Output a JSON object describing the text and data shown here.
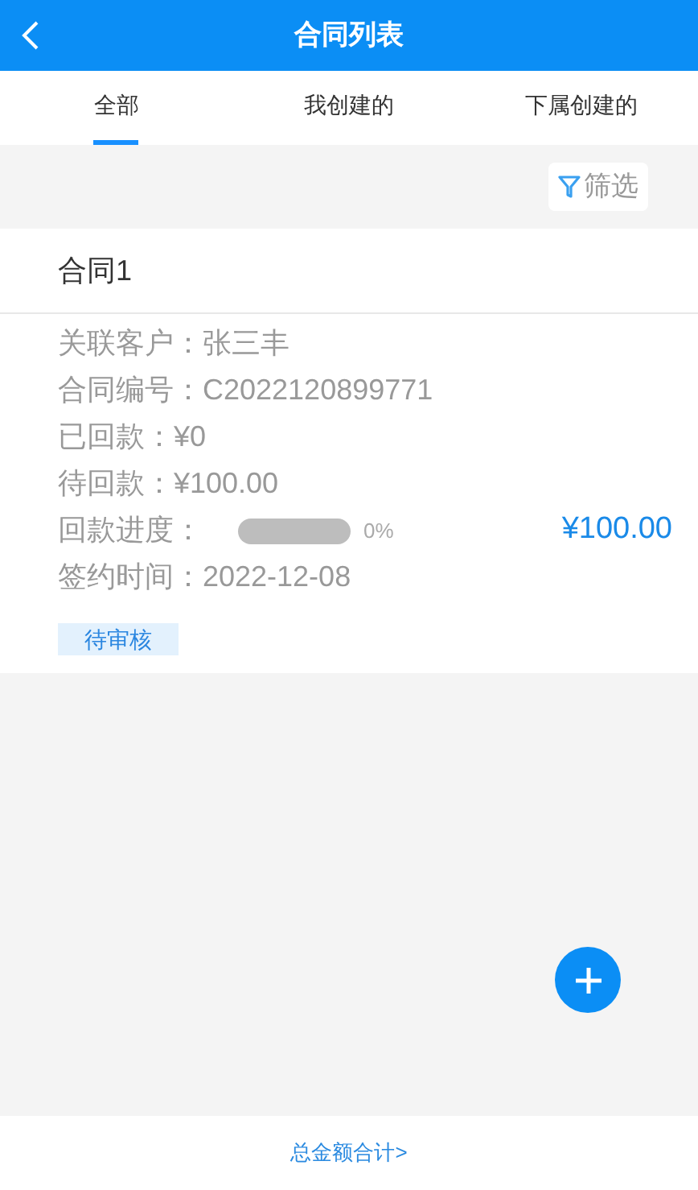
{
  "header": {
    "title": "合同列表"
  },
  "tabs": [
    {
      "label": "全部",
      "selected": true
    },
    {
      "label": "我创建的",
      "selected": false
    },
    {
      "label": "下属创建的",
      "selected": false
    }
  ],
  "filter": {
    "label": "筛选"
  },
  "contracts": [
    {
      "title": "合同1",
      "fields": [
        {
          "kind": "text",
          "text": "关联客户：张三丰"
        },
        {
          "kind": "text",
          "text": "合同编号：C2022120899771"
        },
        {
          "kind": "text",
          "text": "已回款：¥0"
        },
        {
          "kind": "text",
          "text": "待回款：¥100.00"
        },
        {
          "kind": "progress",
          "text": "回款进度：",
          "level": 0,
          "reading": "0%",
          "amount": "¥100.00"
        },
        {
          "kind": "text",
          "text": "签约时间：2022-12-08"
        }
      ],
      "status": "待审核"
    }
  ],
  "footer": {
    "link": "总金额合计>"
  }
}
